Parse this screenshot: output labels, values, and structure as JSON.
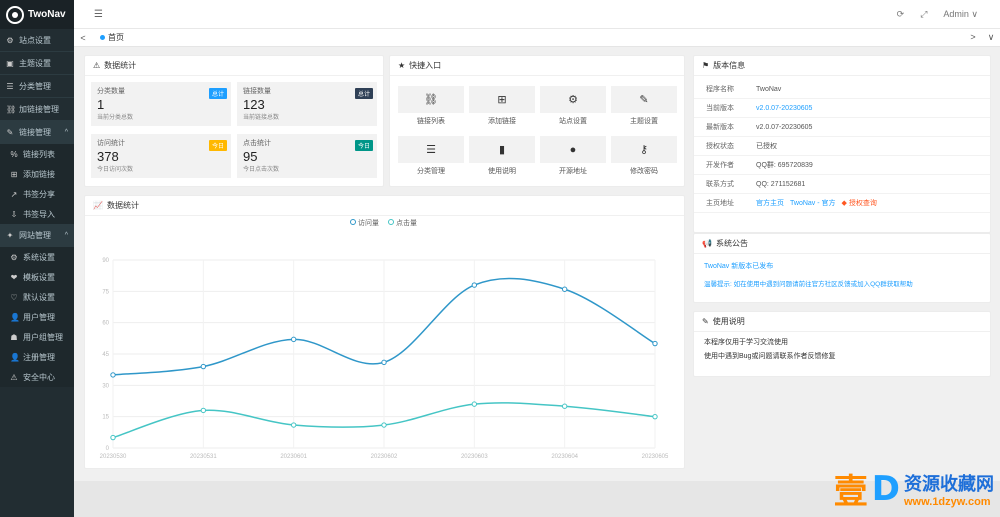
{
  "brand": {
    "title": "TwoNav"
  },
  "sidebar": {
    "items": [
      {
        "icon": "gear-icon",
        "glyph": "⚙",
        "label": "站点设置"
      },
      {
        "icon": "theme-icon",
        "glyph": "▣",
        "label": "主题设置"
      },
      {
        "icon": "category-icon",
        "glyph": "☰",
        "label": "分类管理"
      },
      {
        "icon": "link-icon",
        "glyph": "⛓",
        "label": "加链接管理"
      }
    ],
    "group": {
      "icon": "link-manage-icon",
      "glyph": "✎",
      "label": "链接管理",
      "arrow": "^"
    },
    "group_items": [
      {
        "icon": "list-icon",
        "glyph": "%",
        "label": "链接列表"
      },
      {
        "icon": "add-icon",
        "glyph": "⊞",
        "label": "添加链接"
      },
      {
        "icon": "share-icon",
        "glyph": "↗",
        "label": "书签分享"
      },
      {
        "icon": "import-icon",
        "glyph": "⇩",
        "label": "书签导入"
      }
    ],
    "system": {
      "icon": "wrench-icon",
      "glyph": "✦",
      "label": "网站管理",
      "arrow": "^"
    },
    "system_items": [
      {
        "icon": "settings-icon",
        "glyph": "⚙",
        "label": "系统设置"
      },
      {
        "icon": "theme2-icon",
        "glyph": "❤",
        "label": "模板设置"
      },
      {
        "icon": "default-icon",
        "glyph": "♡",
        "label": "默认设置"
      },
      {
        "icon": "user-icon",
        "glyph": "👤",
        "label": "用户管理"
      },
      {
        "icon": "group-icon",
        "glyph": "☗",
        "label": "用户组管理"
      },
      {
        "icon": "account-icon",
        "glyph": "👤",
        "label": "注册管理"
      },
      {
        "icon": "warning-icon",
        "glyph": "⚠",
        "label": "安全中心"
      }
    ]
  },
  "topbar": {
    "menu_glyph": "☰",
    "refresh_glyph": "⟳",
    "fullscreen_glyph": "⤢",
    "user": "Admin ∨"
  },
  "tabs": {
    "left_glyph": "<",
    "home": "首页",
    "right_glyph": ">",
    "more_glyph": "∨"
  },
  "stats_card": {
    "title": "数据统计",
    "items": [
      {
        "label": "分类数量",
        "badge": "总计",
        "badge_color": "#1e9fff",
        "value": "1",
        "sub": "当前分类总数"
      },
      {
        "label": "链接数量",
        "badge": "总计",
        "badge_color": "#2f4056",
        "value": "123",
        "sub": "当前链接总数"
      },
      {
        "label": "访问统计",
        "badge": "今日",
        "badge_color": "#ffb800",
        "value": "378",
        "sub": "今日访问次数"
      },
      {
        "label": "点击统计",
        "badge": "今日",
        "badge_color": "#009688",
        "value": "95",
        "sub": "今日点击次数"
      }
    ]
  },
  "quick_card": {
    "title": "快捷入口",
    "items": [
      {
        "icon": "link-icon",
        "glyph": "⛓",
        "label": "链接列表"
      },
      {
        "icon": "add-icon",
        "glyph": "⊞",
        "label": "添加链接"
      },
      {
        "icon": "gear-icon",
        "glyph": "⚙",
        "label": "站点设置"
      },
      {
        "icon": "magic-icon",
        "glyph": "✎",
        "label": "主题设置"
      },
      {
        "icon": "list-icon",
        "glyph": "☰",
        "label": "分类管理"
      },
      {
        "icon": "book-icon",
        "glyph": "▮",
        "label": "使用说明"
      },
      {
        "icon": "github-icon",
        "glyph": "●",
        "label": "开源地址"
      },
      {
        "icon": "key-icon",
        "glyph": "⚷",
        "label": "修改密码"
      }
    ]
  },
  "info_card": {
    "title": "版本信息",
    "rows": [
      {
        "k": "程序名称",
        "v": "TwoNav",
        "link": false
      },
      {
        "k": "当前版本",
        "v": "v2.0.07-20230605",
        "link": true
      },
      {
        "k": "最新版本",
        "v": "v2.0.07-20230605",
        "link": false
      },
      {
        "k": "授权状态",
        "v": "已授权",
        "link": false
      },
      {
        "k": "开发作者",
        "v": "QQ群: 695720839",
        "link": false
      },
      {
        "k": "联系方式",
        "v": "QQ: 271152681",
        "link": false
      }
    ],
    "last": {
      "k": "主页地址",
      "v1": "官方主页",
      "v2": "TwoNav - 官方",
      "v3": "◆ 授权查询"
    }
  },
  "notice_card": {
    "title": "系统公告",
    "lines": [
      "TwoNav 新版本已发布",
      "温馨提示: 如在使用中遇到问题请前往官方社区反馈或加入QQ群获取帮助"
    ]
  },
  "tips_card": {
    "title": "使用说明",
    "lines": [
      "本程序仅用于学习交流使用",
      "使用中遇到Bug或问题请联系作者反馈修复"
    ]
  },
  "chart_card": {
    "title": "数据统计"
  },
  "chart_data": {
    "type": "line",
    "categories": [
      "20230530",
      "20230531",
      "20230601",
      "20230602",
      "20230603",
      "20230604",
      "20230605"
    ],
    "series": [
      {
        "name": "访问量",
        "color": "#2f97c9",
        "values": [
          35,
          39,
          52,
          41,
          78,
          76,
          50
        ]
      },
      {
        "name": "点击量",
        "color": "#45c5c5",
        "values": [
          5,
          18,
          11,
          11,
          21,
          20,
          15
        ]
      }
    ],
    "yticks": [
      "0",
      "15",
      "30",
      "45",
      "60",
      "75",
      "90"
    ],
    "ylim": [
      0,
      90
    ]
  },
  "watermark": {
    "big": "壹",
    "d": "D",
    "cn": "资源收藏网",
    "url": "www.1dzyw.com"
  }
}
